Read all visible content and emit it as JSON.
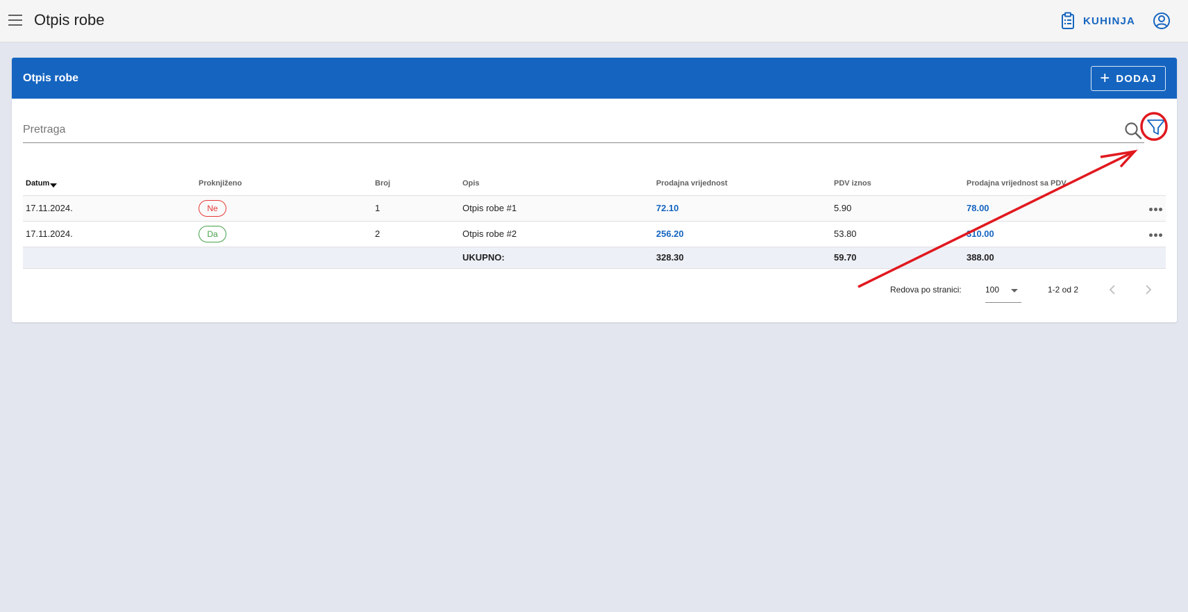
{
  "app": {
    "title": "Otpis robe"
  },
  "topbar": {
    "kitchen_label": "KUHINJA"
  },
  "card": {
    "title": "Otpis robe",
    "add_label": "DODAJ"
  },
  "search": {
    "placeholder": "Pretraga",
    "value": ""
  },
  "table": {
    "columns": [
      "Datum",
      "Proknjiženo",
      "Broj",
      "Opis",
      "Prodajna vrijednost",
      "PDV iznos",
      "Prodajna vrijednost sa PDV"
    ],
    "sorted_column": "Datum",
    "rows": [
      {
        "datum": "17.11.2024.",
        "proknjizeno": "Ne",
        "broj": "1",
        "opis": "Otpis robe #1",
        "prodajna": "72.10",
        "pdv": "5.90",
        "sa_pdv": "78.00"
      },
      {
        "datum": "17.11.2024.",
        "proknjizeno": "Da",
        "broj": "2",
        "opis": "Otpis robe #2",
        "prodajna": "256.20",
        "pdv": "53.80",
        "sa_pdv": "310.00"
      }
    ],
    "total": {
      "label": "UKUPNO:",
      "prodajna": "328.30",
      "pdv": "59.70",
      "sa_pdv": "388.00"
    }
  },
  "pagination": {
    "rows_label": "Redova po stranici:",
    "rows_per_page": "100",
    "range": "1-2 od 2"
  },
  "colors": {
    "primary": "#1565c0",
    "annotation": "#e0191f",
    "no_badge": "#e53935",
    "yes_badge": "#43a047"
  }
}
